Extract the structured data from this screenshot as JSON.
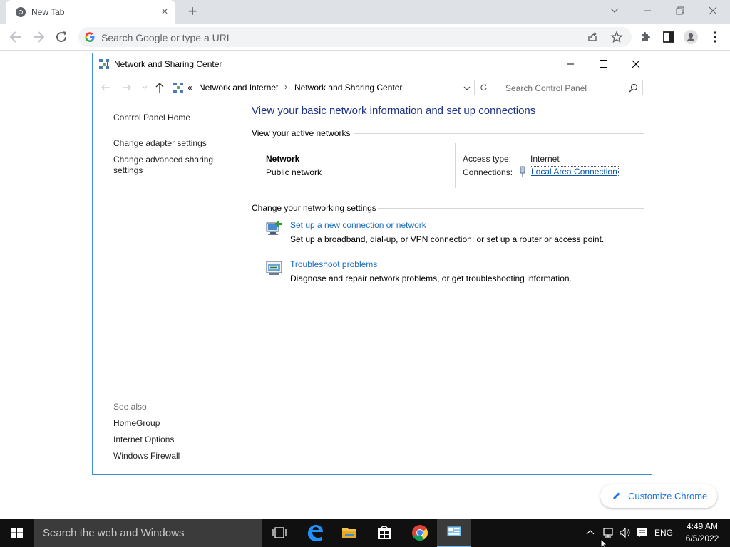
{
  "browser": {
    "tab": {
      "title": "New Tab",
      "favicon": "chrome-icon",
      "close_icon": "close-icon"
    },
    "new_tab_icon": "plus-icon",
    "window_controls": [
      "chevron-down-icon",
      "minimize-icon",
      "restore-icon",
      "close-icon"
    ],
    "toolbar": {
      "omnibox_placeholder": "Search Google or type a URL",
      "icons": [
        "back-icon",
        "forward-icon",
        "reload-icon",
        "google-icon",
        "share-icon",
        "star-icon",
        "puzzle-icon",
        "side-panel-icon",
        "avatar-icon",
        "more-icon"
      ]
    },
    "customize_chrome": {
      "label": "Customize Chrome",
      "icon": "pencil-icon"
    }
  },
  "control_panel": {
    "title": "Network and Sharing Center",
    "address": {
      "chevrons": "«",
      "crumbs": [
        "Network and Internet",
        "Network and Sharing Center"
      ],
      "separator": "›"
    },
    "search_placeholder": "Search Control Panel",
    "left_pane": {
      "home": "Control Panel Home",
      "links": [
        "Change adapter settings",
        "Change advanced sharing settings"
      ],
      "see_also_title": "See also",
      "see_also": [
        "HomeGroup",
        "Internet Options",
        "Windows Firewall"
      ]
    },
    "main": {
      "heading": "View your basic network information and set up connections",
      "active_networks_title": "View your active networks",
      "network": {
        "name": "Network",
        "type": "Public network",
        "access_type_label": "Access type:",
        "access_type_value": "Internet",
        "connections_label": "Connections:",
        "connection_link": "Local Area Connection"
      },
      "change_title": "Change your networking settings",
      "tasks": [
        {
          "link": "Set up a new connection or network",
          "description": "Set up a broadband, dial-up, or VPN connection; or set up a router or access point.",
          "icon": "new-connection-icon"
        },
        {
          "link": "Troubleshoot problems",
          "description": "Diagnose and repair network problems, or get troubleshooting information.",
          "icon": "troubleshoot-icon"
        }
      ]
    }
  },
  "taskbar": {
    "search_text": "Search the web and Windows",
    "apps": [
      "task-view-icon",
      "edge-icon",
      "file-explorer-icon",
      "store-icon",
      "chrome-icon",
      "control-panel-icon"
    ],
    "tray": {
      "language": "ENG",
      "time": "4:49 AM",
      "date": "6/5/2022"
    }
  },
  "colors": {
    "accent_link": "#1c6cbe",
    "heading": "#1e3287",
    "window_border": "#3a8fd6",
    "taskbar": "#101010"
  }
}
